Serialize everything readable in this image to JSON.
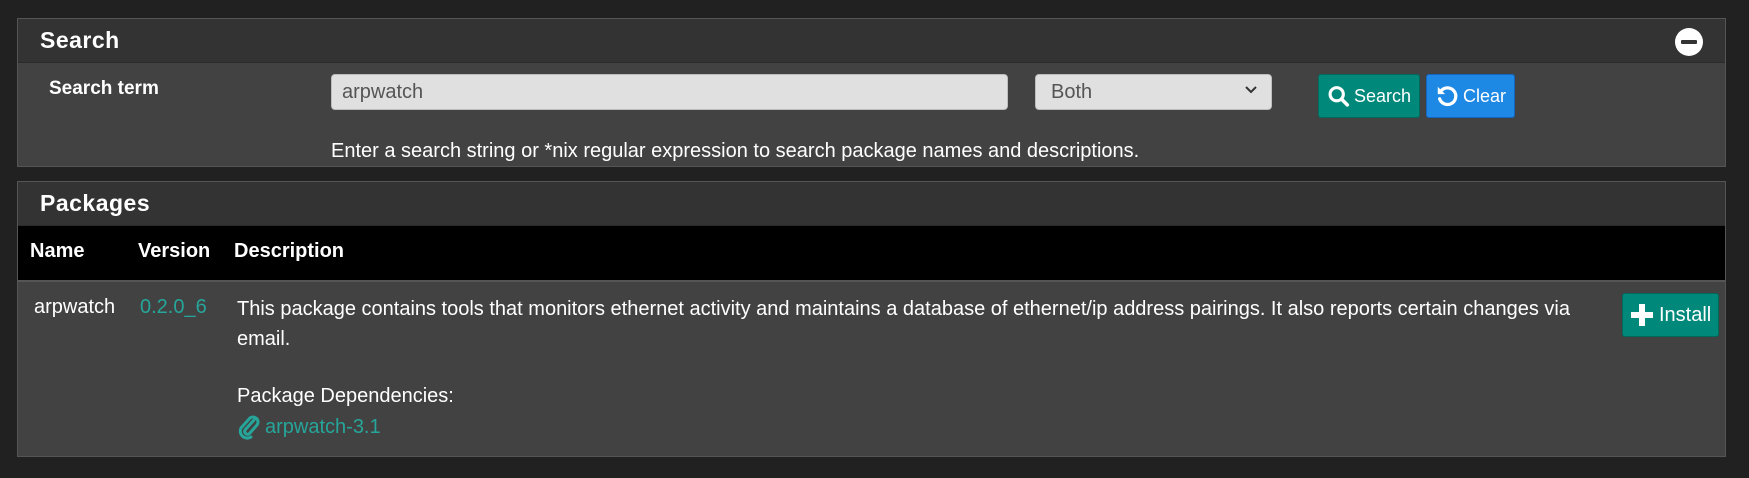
{
  "search_panel": {
    "title": "Search",
    "search_term_label": "Search term",
    "search_input_value": "arpwatch",
    "search_scope_selected": "Both",
    "search_button": "Search",
    "clear_button": "Clear",
    "help_text": "Enter a search string or *nix regular expression to search package names and descriptions."
  },
  "packages_panel": {
    "title": "Packages",
    "columns": [
      "Name",
      "Version",
      "Description"
    ],
    "rows": [
      {
        "name": "arpwatch",
        "version": "0.2.0_6",
        "description": "This package contains tools that monitors ethernet activity and maintains a database of ethernet/ip address pairings. It also reports certain changes via email.",
        "dependencies_label": "Package Dependencies:",
        "dependency": "arpwatch-3.1",
        "install_button": "Install"
      }
    ]
  },
  "colors": {
    "background": "#212121",
    "panel": "#424242",
    "panel_header": "#333333",
    "table_header": "#000000",
    "accent_green": "#00897b",
    "accent_blue": "#1e88e5",
    "link_teal": "#26a69a"
  },
  "icons": {
    "collapse": "minus-circle-icon",
    "search": "search-icon",
    "clear": "undo-icon",
    "install": "plus-icon",
    "dependency": "paperclip-icon",
    "select": "chevron-down-icon"
  }
}
